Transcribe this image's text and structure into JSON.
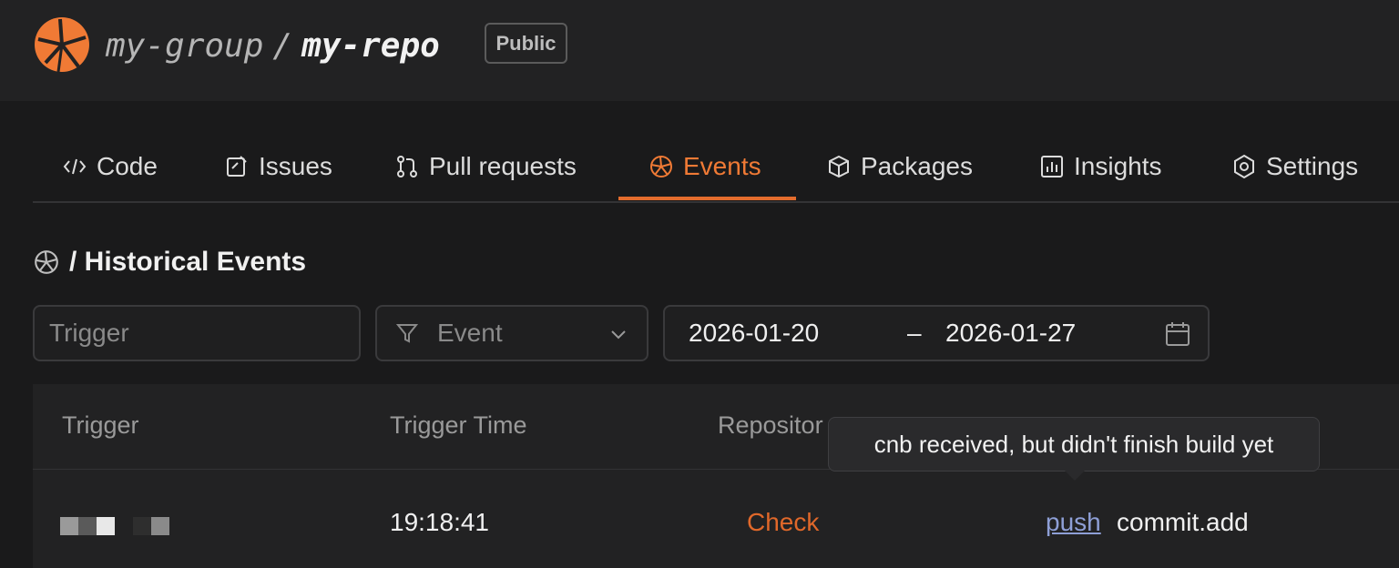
{
  "header": {
    "logo_icon": "cnb-logo-icon",
    "group": "my-group",
    "separator": "/",
    "repo": "my-repo",
    "visibility_badge": "Public",
    "accent_color": "#f07a35"
  },
  "tabs": [
    {
      "label": "Code",
      "icon": "code-icon",
      "active": false
    },
    {
      "label": "Issues",
      "icon": "issues-icon",
      "active": false
    },
    {
      "label": "Pull requests",
      "icon": "pull-request-icon",
      "active": false
    },
    {
      "label": "Events",
      "icon": "events-icon",
      "active": true
    },
    {
      "label": "Packages",
      "icon": "package-icon",
      "active": false
    },
    {
      "label": "Insights",
      "icon": "insights-icon",
      "active": false
    },
    {
      "label": "Settings",
      "icon": "settings-icon",
      "active": false
    }
  ],
  "page": {
    "title": "/ Historical Events",
    "title_icon": "events-icon"
  },
  "filters": {
    "trigger_placeholder": "Trigger",
    "event_placeholder": "Event",
    "date_start": "2026-01-20",
    "date_separator": "–",
    "date_end": "2026-01-27"
  },
  "table": {
    "columns": [
      "Trigger",
      "Trigger Time",
      "Repositor"
    ],
    "rows": [
      {
        "trigger_avatar": "pixel-avatar",
        "trigger_time": "19:18:41",
        "repository_action": "Check",
        "event_type": "push",
        "event_name": "commit.add"
      }
    ]
  },
  "tooltip": {
    "text": "cnb received, but didn't finish build yet"
  }
}
